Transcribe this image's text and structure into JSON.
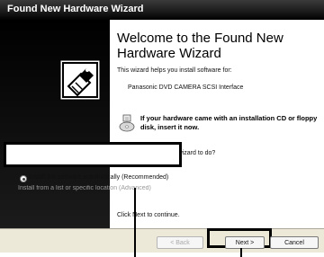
{
  "window": {
    "title": "Found New Hardware Wizard"
  },
  "wizard": {
    "heading": "Welcome to the Found New Hardware Wizard",
    "intro": "This wizard helps you install software for:",
    "device": "Panasonic DVD CAMERA SCSI Interface",
    "cd_notice": "If your hardware came with an installation CD or floppy disk, insert it now.",
    "question": "What do you want the wizard to do?",
    "options": [
      {
        "label": "Install the software automatically (Recommended)",
        "selected": true
      },
      {
        "label": "Install from a list or specific location (Advanced)",
        "selected": false
      }
    ],
    "continue_text": "Click Next to continue."
  },
  "buttons": {
    "back": "< Back",
    "next": "Next >",
    "cancel": "Cancel"
  },
  "colors": {
    "title_bar": "#000000",
    "side_panel": "#000000",
    "bottom_bar": "#ece9d8"
  }
}
